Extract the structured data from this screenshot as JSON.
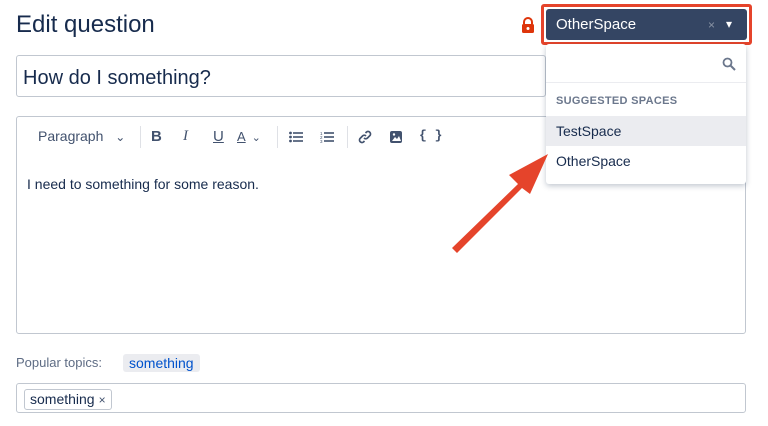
{
  "page": {
    "title": "Edit question"
  },
  "question": {
    "title_value": "How do I something?",
    "body_text": "I need to something for some reason."
  },
  "space_selector": {
    "selected": "OtherSpace",
    "clear_icon": "×",
    "caret_icon": "▾"
  },
  "dropdown": {
    "search_placeholder": "",
    "heading": "SUGGESTED SPACES",
    "items": [
      {
        "label": "TestSpace"
      },
      {
        "label": "OtherSpace"
      }
    ]
  },
  "toolbar": {
    "paragraph_label": "Paragraph",
    "bold": "B",
    "italic": "I",
    "underline": "U",
    "text_color": "A",
    "code": "{ }"
  },
  "topics": {
    "label": "Popular topics:",
    "popular": [
      "something"
    ],
    "selected": [
      {
        "label": "something",
        "remove": "×"
      }
    ]
  },
  "colors": {
    "accent_red": "#e5442b",
    "selector_bg": "#344563",
    "link_blue": "#0052cc"
  }
}
